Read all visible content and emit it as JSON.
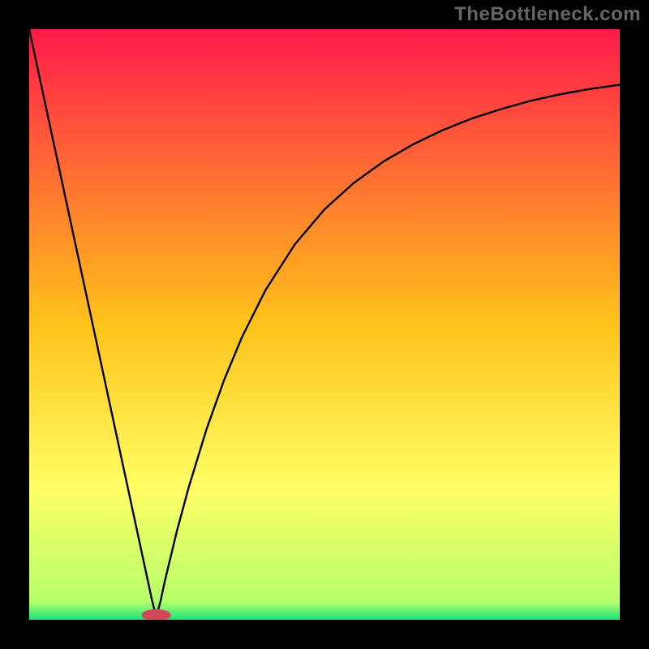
{
  "watermark": "TheBottleneck.com",
  "chart_data": {
    "type": "line",
    "title": "",
    "xlabel": "",
    "ylabel": "",
    "xlim": [
      0,
      100
    ],
    "ylim": [
      0,
      100
    ],
    "grid": false,
    "legend": false,
    "background_gradient_stops": [
      {
        "offset": 0,
        "color": "#ff1b4b"
      },
      {
        "offset": 50,
        "color": "#ffc31a"
      },
      {
        "offset": 78,
        "color": "#ffff66"
      },
      {
        "offset": 97,
        "color": "#b4ff6a"
      },
      {
        "offset": 100,
        "color": "#18e37a"
      }
    ],
    "marker": {
      "x": 21.5,
      "y": 0.8,
      "color": "#d1495b",
      "rx": 2.5,
      "ry": 1.0
    },
    "series": [
      {
        "name": "bottleneck-curve",
        "color": "#000000",
        "x": [
          0,
          2,
          4,
          6,
          8,
          10,
          12,
          14,
          16,
          18,
          20,
          20.8,
          21.5,
          22.2,
          23,
          25,
          27,
          30,
          33,
          36,
          40,
          45,
          50,
          55,
          60,
          65,
          70,
          75,
          80,
          85,
          90,
          95,
          100
        ],
        "y": [
          100,
          90.7,
          81.4,
          72.1,
          62.8,
          53.5,
          44.2,
          34.9,
          25.6,
          16.3,
          7.0,
          3.3,
          0.5,
          3.0,
          6.7,
          15.0,
          22.4,
          32.2,
          40.6,
          47.8,
          55.8,
          63.6,
          69.5,
          74.0,
          77.6,
          80.5,
          82.9,
          84.9,
          86.5,
          87.9,
          89.0,
          89.9,
          90.6
        ]
      }
    ]
  }
}
